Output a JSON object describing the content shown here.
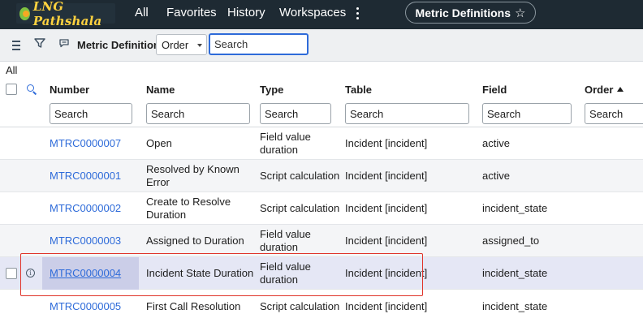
{
  "header": {
    "logo_text": "LNG Pathshala",
    "nav": [
      "All",
      "Favorites",
      "History",
      "Workspaces"
    ],
    "current_page_pill": "Metric Definitions"
  },
  "toolbar": {
    "title": "Metric Definitions",
    "select_value": "Order",
    "search_value": "Search"
  },
  "breadcrumb": "All",
  "table": {
    "columns": [
      "Number",
      "Name",
      "Type",
      "Table",
      "Field",
      "Order"
    ],
    "filter_placeholders": [
      "Search",
      "Search",
      "Search",
      "Search",
      "Search",
      "Search"
    ],
    "rows": [
      {
        "number": "MTRC0000007",
        "name": [
          "Open"
        ],
        "type": [
          "Field value",
          "duration"
        ],
        "table": "Incident [incident]",
        "field": "active"
      },
      {
        "number": "MTRC0000001",
        "name": [
          "Resolved by Known",
          "Error"
        ],
        "type": [
          "Script calculation"
        ],
        "table": "Incident [incident]",
        "field": "active"
      },
      {
        "number": "MTRC0000002",
        "name": [
          "Create to Resolve",
          "Duration"
        ],
        "type": [
          "Script calculation"
        ],
        "table": "Incident [incident]",
        "field": "incident_state"
      },
      {
        "number": "MTRC0000003",
        "name": [
          "Assigned to Duration"
        ],
        "type": [
          "Field value",
          "duration"
        ],
        "table": "Incident [incident]",
        "field": "assigned_to"
      },
      {
        "number": "MTRC0000004",
        "name": [
          "Incident State Duration"
        ],
        "type": [
          "Field value",
          "duration"
        ],
        "table": "Incident [incident]",
        "field": "incident_state"
      },
      {
        "number": "MTRC0000005",
        "name": [
          "First Call Resolution"
        ],
        "type": [
          "Script calculation"
        ],
        "table": "Incident [incident]",
        "field": "incident_state"
      }
    ]
  },
  "colors": {
    "topbar": "#1e2a33",
    "link": "#2e6bd9",
    "selected_row": "#e5e7f5",
    "highlight_border": "#e0342a"
  },
  "icons": [
    "menu-icon",
    "filter-icon",
    "comment-icon",
    "search-icon",
    "info-icon",
    "star-icon",
    "more-icon",
    "sort-ascending-icon"
  ]
}
